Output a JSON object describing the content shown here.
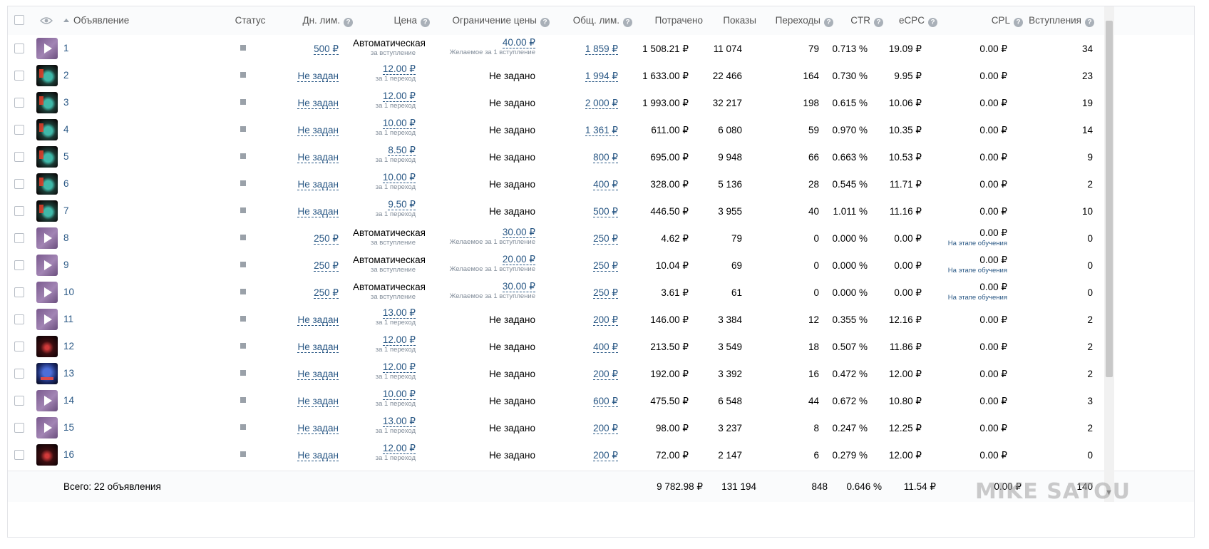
{
  "header": {
    "ad": "Объявление",
    "status": "Статус",
    "daily_limit": "Дн. лим.",
    "price": "Цена",
    "price_limit": "Ограничение цены",
    "total_limit": "Общ. лим.",
    "spent": "Потрачено",
    "impressions": "Показы",
    "clicks": "Переходы",
    "ctr": "CTR",
    "ecpc": "eCPC",
    "cpl": "CPL",
    "joins": "Вступления",
    "help_glyph": "?"
  },
  "rows": [
    {
      "name": "1",
      "thumb": "play",
      "daily": "500 ₽",
      "price": "Автоматическая",
      "price_sub": "за вступление",
      "price_auto": true,
      "limit": "40.00 ₽",
      "limit_sub": "Желаемое за 1 вступление",
      "limit_set": true,
      "total": "1 859 ₽",
      "spent": "1 508.21 ₽",
      "impr": "11 074",
      "clicks": "79",
      "ctr": "0.713 %",
      "ecpc": "19.09 ₽",
      "cpl": "0.00 ₽",
      "cpl_sub": "",
      "joins": "34"
    },
    {
      "name": "2",
      "thumb": "game",
      "daily": "Не задан",
      "price": "12.00 ₽",
      "price_sub": "за 1 переход",
      "price_auto": false,
      "limit": "Не задано",
      "limit_sub": "",
      "limit_set": false,
      "total": "1 994 ₽",
      "spent": "1 633.00 ₽",
      "impr": "22 466",
      "clicks": "164",
      "ctr": "0.730 %",
      "ecpc": "9.95 ₽",
      "cpl": "0.00 ₽",
      "cpl_sub": "",
      "joins": "23"
    },
    {
      "name": "3",
      "thumb": "game",
      "daily": "Не задан",
      "price": "12.00 ₽",
      "price_sub": "за 1 переход",
      "price_auto": false,
      "limit": "Не задано",
      "limit_sub": "",
      "limit_set": false,
      "total": "2 000 ₽",
      "spent": "1 993.00 ₽",
      "impr": "32 217",
      "clicks": "198",
      "ctr": "0.615 %",
      "ecpc": "10.06 ₽",
      "cpl": "0.00 ₽",
      "cpl_sub": "",
      "joins": "19"
    },
    {
      "name": "4",
      "thumb": "game",
      "daily": "Не задан",
      "price": "10.00 ₽",
      "price_sub": "за 1 переход",
      "price_auto": false,
      "limit": "Не задано",
      "limit_sub": "",
      "limit_set": false,
      "total": "1 361 ₽",
      "spent": "611.00 ₽",
      "impr": "6 080",
      "clicks": "59",
      "ctr": "0.970 %",
      "ecpc": "10.35 ₽",
      "cpl": "0.00 ₽",
      "cpl_sub": "",
      "joins": "14"
    },
    {
      "name": "5",
      "thumb": "game",
      "daily": "Не задан",
      "price": "8.50 ₽",
      "price_sub": "за 1 переход",
      "price_auto": false,
      "limit": "Не задано",
      "limit_sub": "",
      "limit_set": false,
      "total": "800 ₽",
      "spent": "695.00 ₽",
      "impr": "9 948",
      "clicks": "66",
      "ctr": "0.663 %",
      "ecpc": "10.53 ₽",
      "cpl": "0.00 ₽",
      "cpl_sub": "",
      "joins": "9"
    },
    {
      "name": "6",
      "thumb": "game",
      "daily": "Не задан",
      "price": "10.00 ₽",
      "price_sub": "за 1 переход",
      "price_auto": false,
      "limit": "Не задано",
      "limit_sub": "",
      "limit_set": false,
      "total": "400 ₽",
      "spent": "328.00 ₽",
      "impr": "5 136",
      "clicks": "28",
      "ctr": "0.545 %",
      "ecpc": "11.71 ₽",
      "cpl": "0.00 ₽",
      "cpl_sub": "",
      "joins": "2"
    },
    {
      "name": "7",
      "thumb": "game",
      "daily": "Не задан",
      "price": "9.50 ₽",
      "price_sub": "за 1 переход",
      "price_auto": false,
      "limit": "Не задано",
      "limit_sub": "",
      "limit_set": false,
      "total": "500 ₽",
      "spent": "446.50 ₽",
      "impr": "3 955",
      "clicks": "40",
      "ctr": "1.011 %",
      "ecpc": "11.16 ₽",
      "cpl": "0.00 ₽",
      "cpl_sub": "",
      "joins": "10"
    },
    {
      "name": "8",
      "thumb": "play",
      "daily": "250 ₽",
      "price": "Автоматическая",
      "price_sub": "за вступление",
      "price_auto": true,
      "limit": "30.00 ₽",
      "limit_sub": "Желаемое за 1 вступление",
      "limit_set": true,
      "total": "250 ₽",
      "spent": "4.62 ₽",
      "impr": "79",
      "clicks": "0",
      "ctr": "0.000 %",
      "ecpc": "0.00 ₽",
      "cpl": "0.00 ₽",
      "cpl_sub": "На этапе обучения",
      "joins": "0"
    },
    {
      "name": "9",
      "thumb": "play",
      "daily": "250 ₽",
      "price": "Автоматическая",
      "price_sub": "за вступление",
      "price_auto": true,
      "limit": "20.00 ₽",
      "limit_sub": "Желаемое за 1 вступление",
      "limit_set": true,
      "total": "250 ₽",
      "spent": "10.04 ₽",
      "impr": "69",
      "clicks": "0",
      "ctr": "0.000 %",
      "ecpc": "0.00 ₽",
      "cpl": "0.00 ₽",
      "cpl_sub": "На этапе обучения",
      "joins": "0"
    },
    {
      "name": "10",
      "thumb": "play",
      "daily": "250 ₽",
      "price": "Автоматическая",
      "price_sub": "за вступление",
      "price_auto": true,
      "limit": "30.00 ₽",
      "limit_sub": "Желаемое за 1 вступление",
      "limit_set": true,
      "total": "250 ₽",
      "spent": "3.61 ₽",
      "impr": "61",
      "clicks": "0",
      "ctr": "0.000 %",
      "ecpc": "0.00 ₽",
      "cpl": "0.00 ₽",
      "cpl_sub": "На этапе обучения",
      "joins": "0"
    },
    {
      "name": "11",
      "thumb": "play",
      "daily": "Не задан",
      "price": "13.00 ₽",
      "price_sub": "за 1 переход",
      "price_auto": false,
      "limit": "Не задано",
      "limit_sub": "",
      "limit_set": false,
      "total": "200 ₽",
      "spent": "146.00 ₽",
      "impr": "3 384",
      "clicks": "12",
      "ctr": "0.355 %",
      "ecpc": "12.16 ₽",
      "cpl": "0.00 ₽",
      "cpl_sub": "",
      "joins": "2"
    },
    {
      "name": "12",
      "thumb": "red",
      "daily": "Не задан",
      "price": "12.00 ₽",
      "price_sub": "за 1 переход",
      "price_auto": false,
      "limit": "Не задано",
      "limit_sub": "",
      "limit_set": false,
      "total": "400 ₽",
      "spent": "213.50 ₽",
      "impr": "3 549",
      "clicks": "18",
      "ctr": "0.507 %",
      "ecpc": "11.86 ₽",
      "cpl": "0.00 ₽",
      "cpl_sub": "",
      "joins": "2"
    },
    {
      "name": "13",
      "thumb": "blue",
      "daily": "Не задан",
      "price": "12.00 ₽",
      "price_sub": "за 1 переход",
      "price_auto": false,
      "limit": "Не задано",
      "limit_sub": "",
      "limit_set": false,
      "total": "200 ₽",
      "spent": "192.00 ₽",
      "impr": "3 392",
      "clicks": "16",
      "ctr": "0.472 %",
      "ecpc": "12.00 ₽",
      "cpl": "0.00 ₽",
      "cpl_sub": "",
      "joins": "2"
    },
    {
      "name": "14",
      "thumb": "play",
      "daily": "Не задан",
      "price": "10.00 ₽",
      "price_sub": "за 1 переход",
      "price_auto": false,
      "limit": "Не задано",
      "limit_sub": "",
      "limit_set": false,
      "total": "600 ₽",
      "spent": "475.50 ₽",
      "impr": "6 548",
      "clicks": "44",
      "ctr": "0.672 %",
      "ecpc": "10.80 ₽",
      "cpl": "0.00 ₽",
      "cpl_sub": "",
      "joins": "3"
    },
    {
      "name": "15",
      "thumb": "play",
      "daily": "Не задан",
      "price": "13.00 ₽",
      "price_sub": "за 1 переход",
      "price_auto": false,
      "limit": "Не задано",
      "limit_sub": "",
      "limit_set": false,
      "total": "200 ₽",
      "spent": "98.00 ₽",
      "impr": "3 237",
      "clicks": "8",
      "ctr": "0.247 %",
      "ecpc": "12.25 ₽",
      "cpl": "0.00 ₽",
      "cpl_sub": "",
      "joins": "2"
    },
    {
      "name": "16",
      "thumb": "red",
      "daily": "Не задан",
      "price": "12.00 ₽",
      "price_sub": "за 1 переход",
      "price_auto": false,
      "limit": "Не задано",
      "limit_sub": "",
      "limit_set": false,
      "total": "200 ₽",
      "spent": "72.00 ₽",
      "impr": "2 147",
      "clicks": "6",
      "ctr": "0.279 %",
      "ecpc": "12.00 ₽",
      "cpl": "0.00 ₽",
      "cpl_sub": "",
      "joins": "0"
    }
  ],
  "footer": {
    "total_label": "Всего: 22 объявления",
    "spent": "9 782.98 ₽",
    "impr": "131 194",
    "clicks": "848",
    "ctr": "0.646 %",
    "ecpc": "11.54 ₽",
    "cpl": "0.00 ₽",
    "joins": "140"
  },
  "watermark": "MIKE SATOU",
  "colors": {
    "link": "#2a5885",
    "muted": "#818c99",
    "header_bg": "#fafbfc",
    "status": "#9aa1a9"
  }
}
